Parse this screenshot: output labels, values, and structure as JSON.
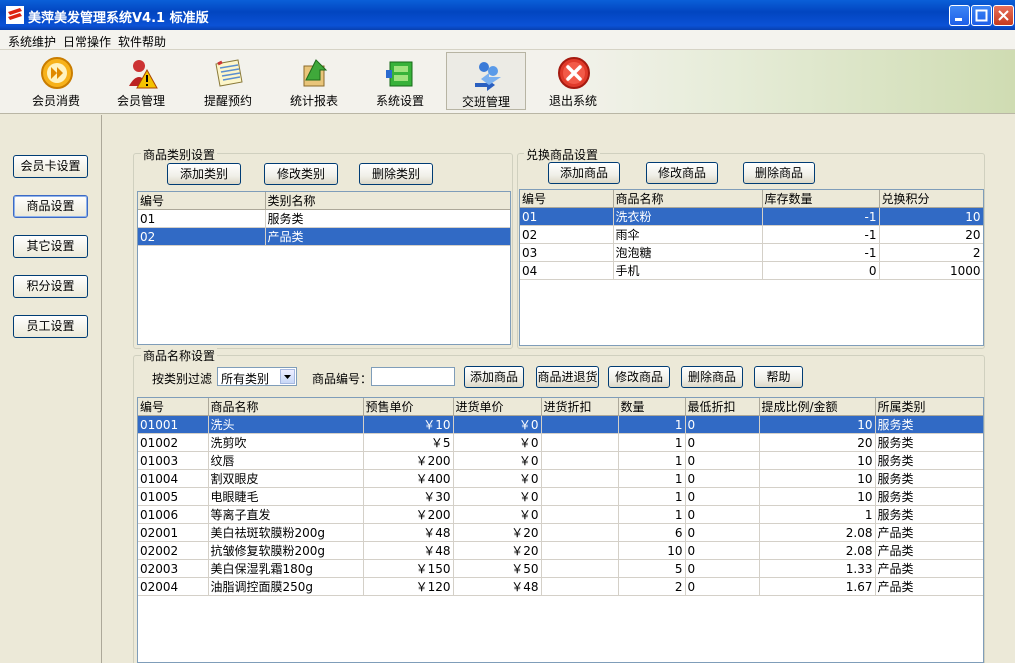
{
  "window": {
    "title": "美萍美发管理系统V4.1 标准版"
  },
  "menu": [
    "系统维护",
    "日常操作",
    "软件帮助"
  ],
  "toolbar": [
    {
      "label": "会员消费",
      "icon": "play-forward-icon"
    },
    {
      "label": "会员管理",
      "icon": "member-warning-icon"
    },
    {
      "label": "提醒预约",
      "icon": "calendar-notepad-icon"
    },
    {
      "label": "统计报表",
      "icon": "report-arrow-icon"
    },
    {
      "label": "系统设置",
      "icon": "settings-box-icon"
    },
    {
      "label": "交班管理",
      "icon": "shift-exchange-icon"
    },
    {
      "label": "退出系统",
      "icon": "exit-close-icon"
    }
  ],
  "sidebar": [
    "会员卡设置",
    "商品设置",
    "其它设置",
    "积分设置",
    "员工设置"
  ],
  "category": {
    "title": "商品类别设置",
    "buttons": [
      "添加类别",
      "修改类别",
      "删除类别"
    ],
    "headers": [
      "编号",
      "类别名称"
    ],
    "rows": [
      [
        "01",
        "服务类"
      ],
      [
        "02",
        "产品类"
      ]
    ]
  },
  "exchange": {
    "title": "兑换商品设置",
    "buttons": [
      "添加商品",
      "修改商品",
      "删除商品"
    ],
    "headers": [
      "编号",
      "商品名称",
      "库存数量",
      "兑换积分"
    ],
    "rows": [
      [
        "01",
        "洗衣粉",
        "-1",
        "10"
      ],
      [
        "02",
        "雨伞",
        "-1",
        "20"
      ],
      [
        "03",
        "泡泡糖",
        "-1",
        "2"
      ],
      [
        "04",
        "手机",
        "0",
        "1000"
      ]
    ]
  },
  "products": {
    "title": "商品名称设置",
    "filter_label": "按类别过滤",
    "filter_value": "所有类别",
    "code_label": "商品编号：",
    "code_value": "",
    "buttons": [
      "添加商品",
      "商品进退货",
      "修改商品",
      "删除商品",
      "帮助"
    ],
    "headers": [
      "编号",
      "商品名称",
      "预售单价",
      "进货单价",
      "进货折扣",
      "数量",
      "最低折扣",
      "提成比例/金额",
      "所属类别"
    ],
    "rows": [
      [
        "01001",
        "洗头",
        "￥10",
        "￥0",
        "",
        "1",
        "0",
        "10",
        "服务类"
      ],
      [
        "01002",
        "洗剪吹",
        "￥5",
        "￥0",
        "",
        "1",
        "0",
        "20",
        "服务类"
      ],
      [
        "01003",
        "纹唇",
        "￥200",
        "￥0",
        "",
        "1",
        "0",
        "10",
        "服务类"
      ],
      [
        "01004",
        "割双眼皮",
        "￥400",
        "￥0",
        "",
        "1",
        "0",
        "10",
        "服务类"
      ],
      [
        "01005",
        "电眼睫毛",
        "￥30",
        "￥0",
        "",
        "1",
        "0",
        "10",
        "服务类"
      ],
      [
        "01006",
        "等离子直发",
        "￥200",
        "￥0",
        "",
        "1",
        "0",
        "1",
        "服务类"
      ],
      [
        "02001",
        "美白祛斑软膜粉200g",
        "￥48",
        "￥20",
        "",
        "6",
        "0",
        "2.08",
        "产品类"
      ],
      [
        "02002",
        "抗皱修复软膜粉200g",
        "￥48",
        "￥20",
        "",
        "10",
        "0",
        "2.08",
        "产品类"
      ],
      [
        "02003",
        "美白保湿乳霜180g",
        "￥150",
        "￥50",
        "",
        "5",
        "0",
        "1.33",
        "产品类"
      ],
      [
        "02004",
        "油脂调控面膜250g",
        "￥120",
        "￥48",
        "",
        "2",
        "0",
        "1.67",
        "产品类"
      ]
    ]
  }
}
